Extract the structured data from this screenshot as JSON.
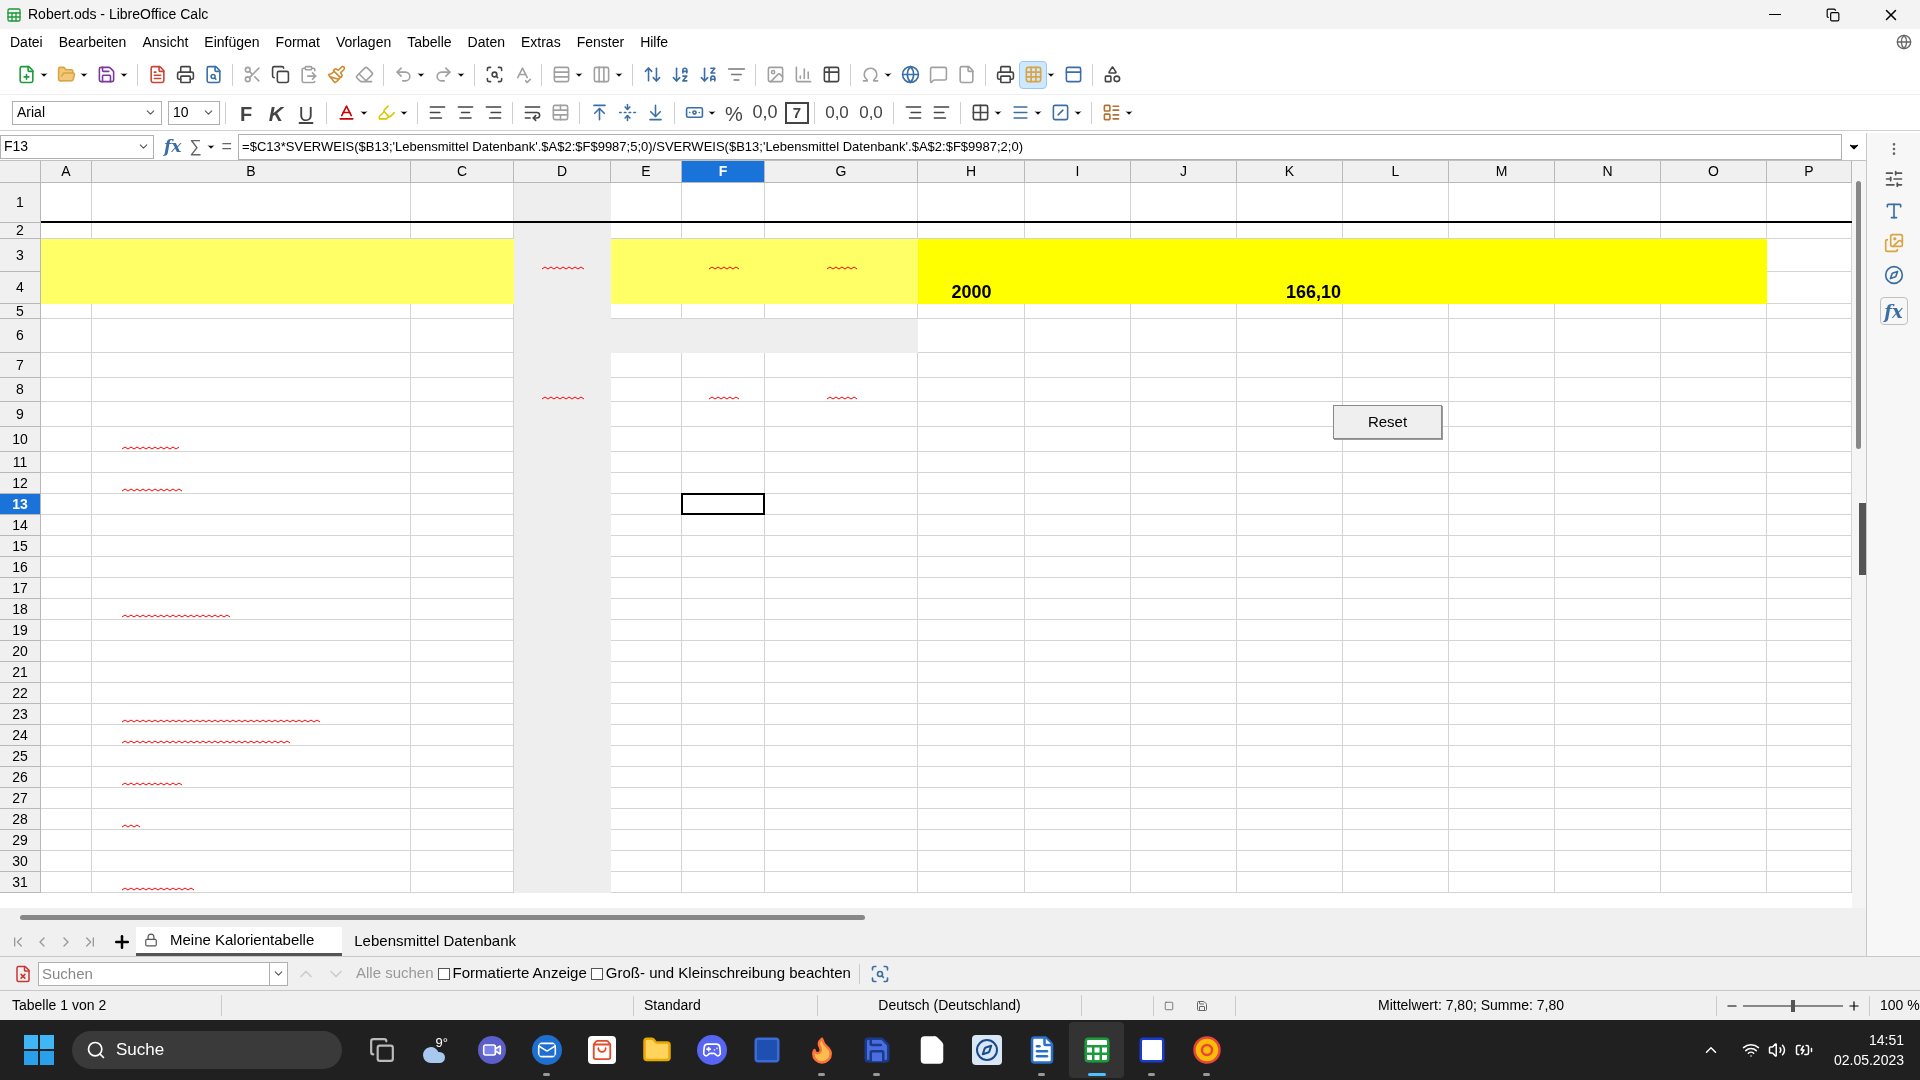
{
  "window": {
    "title": "Robert.ods - LibreOffice Calc"
  },
  "menu": [
    "Datei",
    "Bearbeiten",
    "Ansicht",
    "Einfügen",
    "Format",
    "Vorlagen",
    "Tabelle",
    "Daten",
    "Extras",
    "Fenster",
    "Hilfe"
  ],
  "formatting": {
    "font": "Arial",
    "size": "10",
    "bold": "F",
    "italic": "K",
    "underline": "U",
    "percent": "%",
    "number": "0,0",
    "date": "7",
    "add_decimal": "0,0",
    "remove_decimal": "0,0"
  },
  "formula_bar": {
    "name_box": "F13",
    "wizard": "fx",
    "sum": "∑",
    "equals": "=",
    "formula": "=$C13*SVERWEIS($B13;'Lebensmittel Datenbank'.$A$2:$F$9987;5;0)/SVERWEIS($B13;'Lebensmittel Datenbank'.$A$2:$F$9987;2;0)"
  },
  "columns": [
    {
      "label": "A",
      "selected": false
    },
    {
      "label": "B",
      "selected": false
    },
    {
      "label": "C",
      "selected": false
    },
    {
      "label": "D",
      "selected": false
    },
    {
      "label": "E",
      "selected": false
    },
    {
      "label": "F",
      "selected": true
    },
    {
      "label": "G",
      "selected": false
    },
    {
      "label": "H",
      "selected": false
    },
    {
      "label": "I",
      "selected": false
    },
    {
      "label": "J",
      "selected": false
    },
    {
      "label": "K",
      "selected": false
    },
    {
      "label": "L",
      "selected": false
    },
    {
      "label": "M",
      "selected": false
    },
    {
      "label": "N",
      "selected": false
    },
    {
      "label": "O",
      "selected": false
    },
    {
      "label": "P",
      "selected": false
    }
  ],
  "rows": [
    {
      "label": "1",
      "selected": false
    },
    {
      "label": "2",
      "selected": false
    },
    {
      "label": "3",
      "selected": false
    },
    {
      "label": "4",
      "selected": false
    },
    {
      "label": "5",
      "selected": false
    },
    {
      "label": "6",
      "selected": false
    },
    {
      "label": "7",
      "selected": false
    },
    {
      "label": "8",
      "selected": false
    },
    {
      "label": "9",
      "selected": false
    },
    {
      "label": "10",
      "selected": false
    },
    {
      "label": "11",
      "selected": false
    },
    {
      "label": "12",
      "selected": false
    },
    {
      "label": "13",
      "selected": true
    },
    {
      "label": "14",
      "selected": false
    },
    {
      "label": "15",
      "selected": false
    },
    {
      "label": "16",
      "selected": false
    },
    {
      "label": "17",
      "selected": false
    },
    {
      "label": "18",
      "selected": false
    },
    {
      "label": "19",
      "selected": false
    },
    {
      "label": "20",
      "selected": false
    },
    {
      "label": "21",
      "selected": false
    },
    {
      "label": "22",
      "selected": false
    },
    {
      "label": "23",
      "selected": false
    },
    {
      "label": "24",
      "selected": false
    },
    {
      "label": "25",
      "selected": false
    },
    {
      "label": "26",
      "selected": false
    },
    {
      "label": "27",
      "selected": false
    },
    {
      "label": "28",
      "selected": false
    },
    {
      "label": "29",
      "selected": false
    },
    {
      "label": "30",
      "selected": false
    },
    {
      "label": "31",
      "selected": false
    }
  ],
  "fills": [
    {
      "kind": "left-band",
      "color": "#ffff66"
    },
    {
      "kind": "gray-column",
      "color": "#eeeeee"
    },
    {
      "kind": "middle-band",
      "color": "#ffff66"
    },
    {
      "kind": "gray-strip",
      "color": "#eeeeee"
    },
    {
      "kind": "right-band",
      "color": "#ffff00"
    }
  ],
  "cells": [
    {
      "text": "2000"
    },
    {
      "text": "166,10"
    }
  ],
  "form_button": {
    "label": "Reset"
  },
  "sheet_tabs": [
    {
      "label": "Meine Kalorientabelle",
      "selected": true,
      "locked": true
    },
    {
      "label": "Lebensmittel Datenbank",
      "selected": false,
      "locked": false
    }
  ],
  "find_bar": {
    "placeholder": "Suchen",
    "find_all": "Alle suchen",
    "options": [
      {
        "label": "Formatierte Anzeige",
        "checked": false
      },
      {
        "label": "Groß- und Kleinschreibung beachten",
        "checked": false
      }
    ]
  },
  "status_bar": {
    "sheet": "Tabelle 1 von 2",
    "style": "Standard",
    "language": "Deutsch (Deutschland)",
    "summary": "Mittelwert: 7,80; Summe: 7,80",
    "zoom": {
      "level": 0.5
    },
    "zoom_text": "100 %"
  },
  "sidebar": {
    "functions": "fx"
  },
  "taskbar": {
    "search": "Suche",
    "apps": [
      {
        "kind": "task-view",
        "running": false,
        "active": false
      },
      {
        "kind": "weather",
        "badge": "9°",
        "running": false,
        "active": false
      },
      {
        "kind": "meet",
        "running": false,
        "active": false
      },
      {
        "kind": "mail",
        "running": true,
        "active": false
      },
      {
        "kind": "store",
        "running": false,
        "active": false
      },
      {
        "kind": "folder",
        "running": false,
        "active": false
      },
      {
        "kind": "chat",
        "running": false,
        "active": false
      },
      {
        "kind": "letter-app",
        "running": false,
        "active": false
      },
      {
        "kind": "fox",
        "running": true,
        "active": false
      },
      {
        "kind": "floppy",
        "running": true,
        "active": false
      },
      {
        "kind": "page",
        "running": false,
        "active": false
      },
      {
        "kind": "compass",
        "running": false,
        "active": false
      },
      {
        "kind": "writer",
        "running": true,
        "active": false
      },
      {
        "kind": "calc",
        "running": true,
        "active": true
      },
      {
        "kind": "frame",
        "running": true,
        "active": false
      },
      {
        "kind": "chrome",
        "running": true,
        "active": false
      }
    ],
    "time": "14:51",
    "date": "02.05.2023"
  }
}
